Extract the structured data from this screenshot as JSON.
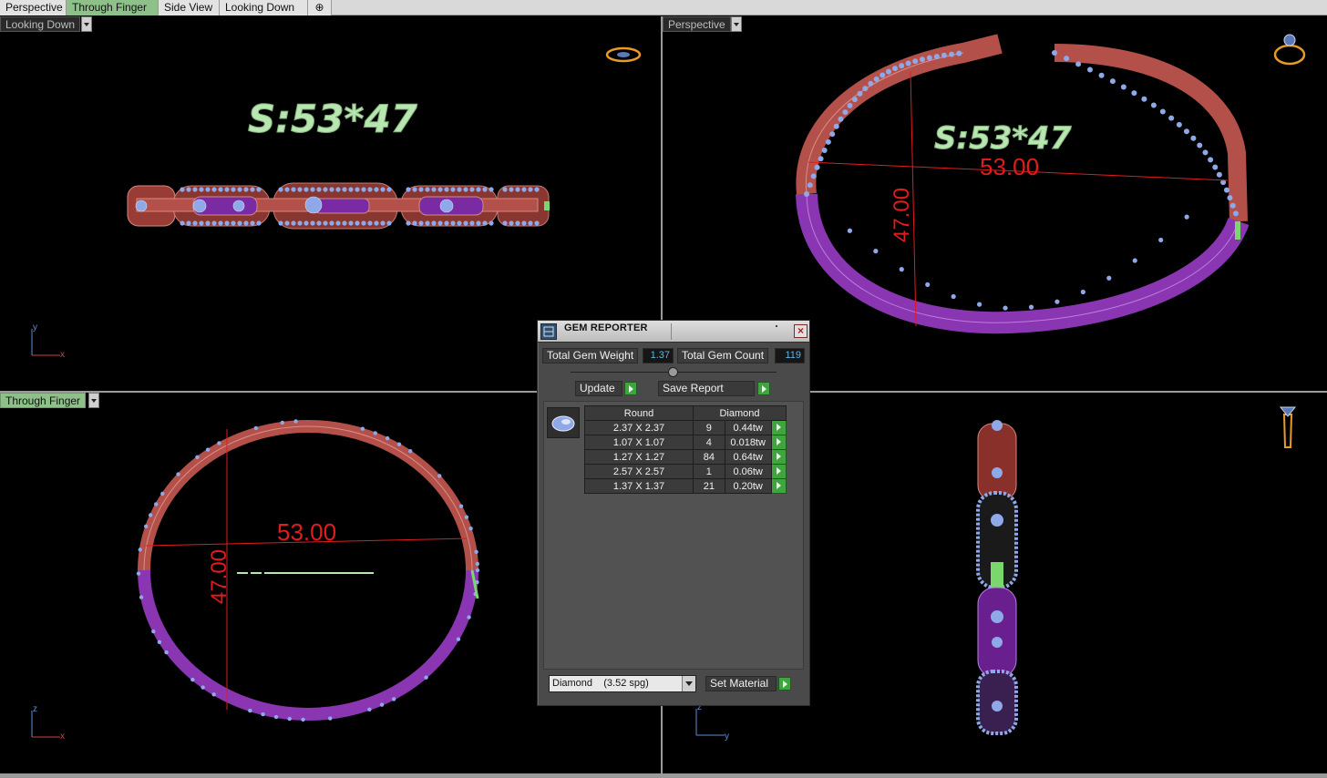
{
  "tabs": [
    {
      "label": "Perspective",
      "active": false
    },
    {
      "label": "Through Finger",
      "active": true
    },
    {
      "label": "Side View",
      "active": false
    },
    {
      "label": "Looking Down",
      "active": false
    }
  ],
  "viewports": {
    "top_left": {
      "label": "Looking Down",
      "text_mark": "S:53*47",
      "axis": [
        "y",
        "x"
      ]
    },
    "top_right": {
      "label": "Perspective",
      "text_mark": "S:53*47",
      "width_dim": "53.00",
      "height_dim": "47.00"
    },
    "bottom_left": {
      "label": "Through Finger",
      "width_dim": "53.00",
      "height_dim": "47.00",
      "axis": [
        "z",
        "x"
      ]
    },
    "bottom_right": {
      "label": "",
      "axis": [
        "z",
        "y"
      ]
    }
  },
  "gem_reporter": {
    "title": "GEM REPORTER",
    "total_weight_label": "Total Gem Weight",
    "total_weight": "1.37",
    "total_count_label": "Total Gem Count",
    "total_count": "119",
    "update_label": "Update",
    "save_report_label": "Save Report",
    "table": {
      "headers": [
        "Round",
        "Diamond"
      ],
      "rows": [
        {
          "size": "2.37 X 2.37",
          "count": "9",
          "weight": "0.44tw"
        },
        {
          "size": "1.07 X 1.07",
          "count": "4",
          "weight": "0.018tw"
        },
        {
          "size": "1.27 X 1.27",
          "count": "84",
          "weight": "0.64tw"
        },
        {
          "size": "2.57 X 2.57",
          "count": "1",
          "weight": "0.06tw"
        },
        {
          "size": "1.37 X 1.37",
          "count": "21",
          "weight": "0.20tw"
        }
      ]
    },
    "material_selected": "Diamond    (3.52 spg)",
    "set_material_label": "Set Material"
  },
  "colors": {
    "red_metal": "#b3504a",
    "purple_metal": "#8a36b3",
    "gem_blue": "#8fa9e8",
    "text_green": "#b8e6b0",
    "dim_red": "#e01c1c",
    "accent_green": "#8ec08a"
  }
}
